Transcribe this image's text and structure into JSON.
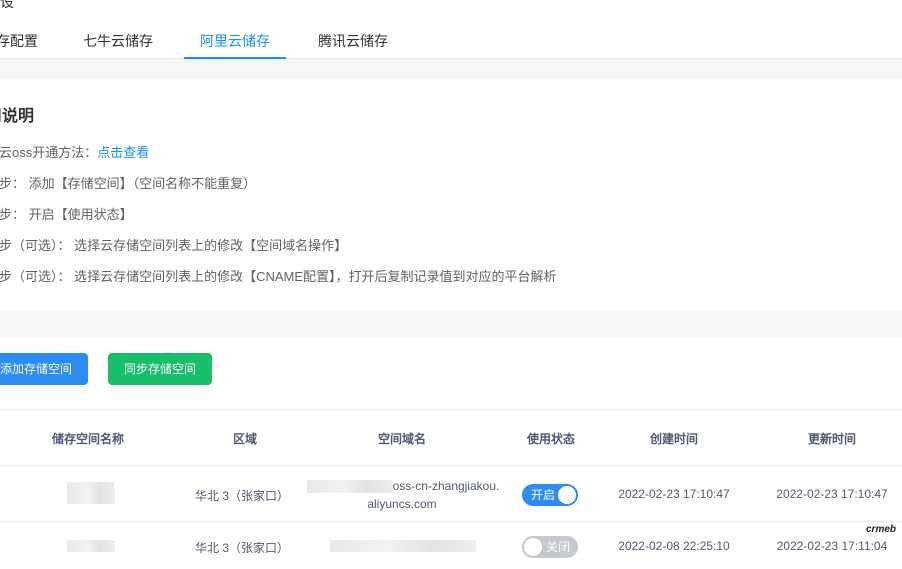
{
  "header": {
    "title_fragment": "设",
    "tabs": [
      {
        "label": "存配置",
        "active": false
      },
      {
        "label": "七牛云储存",
        "active": false
      },
      {
        "label": "阿里云储存",
        "active": true
      },
      {
        "label": "腾讯云储存",
        "active": false
      }
    ]
  },
  "instructions": {
    "title": "用说明",
    "line1_prefix": "里云oss开通方法：",
    "line1_link": "点击查看",
    "line2": "一步：  添加【存储空间】（空间名称不能重复）",
    "line3": "二步：  开启【使用状态】",
    "line4": "三步（可选）：  选择云存储空间列表上的修改【空间域名操作】",
    "line5": "四步（可选）：  选择云存储空间列表上的修改【CNAME配置】，打开后复制记录值到对应的平台解析"
  },
  "toolbar": {
    "add_label": "添加存储空间",
    "sync_label": "同步存储空间"
  },
  "table": {
    "headers": [
      "储存空间名称",
      "区域",
      "空间域名",
      "使用状态",
      "创建时间",
      "更新时间"
    ],
    "rows": [
      {
        "region": "华北 3（张家口）",
        "domain_line1": "oss-cn-zhangjiakou.",
        "domain_line2": "aliyuncs.com",
        "status": "开启",
        "status_on": true,
        "created": "2022-02-23 17:10:47",
        "updated": "2022-02-23 17:10:47"
      },
      {
        "region": "华北 3（张家口）",
        "status": "关闭",
        "status_on": false,
        "created": "2022-02-08 22:25:10",
        "updated": "2022-02-23 17:11:04"
      }
    ]
  },
  "colors": {
    "primary": "#1890ff",
    "button_blue": "#2d8cf0",
    "button_green": "#19be6b",
    "switch_off": "#c5c8ce"
  },
  "watermark": "crmeb"
}
